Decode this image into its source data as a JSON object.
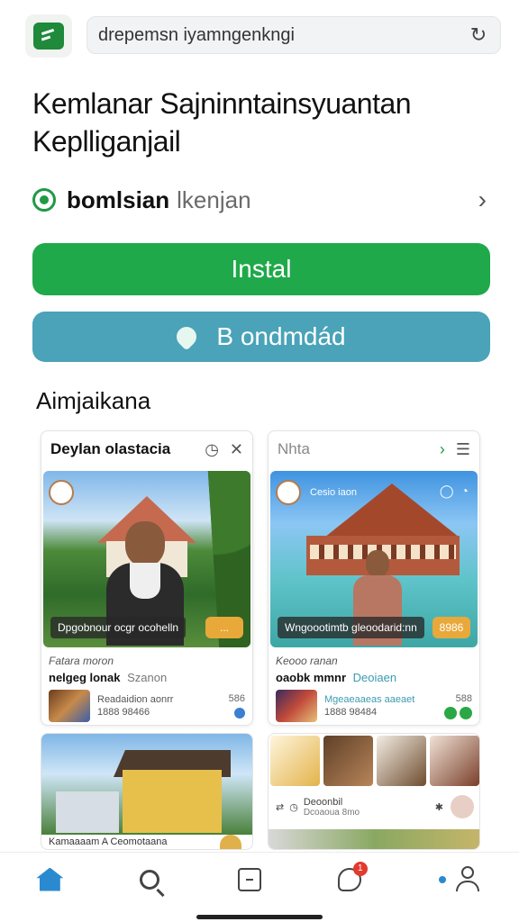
{
  "address_bar": {
    "url_text": "drepemsn iyamngenkngi"
  },
  "page": {
    "title_line1": "Kemlanar Sajninntainsyuantan",
    "title_line2": "Keplliganjail"
  },
  "developer": {
    "name": "bomlsian",
    "sub": "lkenjan"
  },
  "buttons": {
    "install": "Instal",
    "secondary": "B ondmdád"
  },
  "section": {
    "title": "Aimjaikana"
  },
  "cards": [
    {
      "header": "Deylan olastacia",
      "caption": "Dpgobnour ocgr ocohelln",
      "line1": "Fatara moron",
      "line2": "nelgeg lonak",
      "line2_extra": "Szanon",
      "meta1": "Readaidion aonrr",
      "meta2": "1888 98466",
      "side": "586"
    },
    {
      "header": "Nhta",
      "photo_tag": "Cesio iaon",
      "caption": "Wngoootimtb gleoodarid:nn",
      "price": "8986",
      "line1": "Keooo ranan",
      "line2": "oaobk mmnr",
      "line2_extra": "Deoiaen",
      "meta1": "Mgeaeaaeas aaeaet",
      "meta2": "1888 98484",
      "side": "588"
    }
  ],
  "cards_row2": [
    {
      "caption": "Kamaaaam A Ceomotaana"
    },
    {
      "line1": "Deoonbil",
      "line2": "Dcoaoua 8mo"
    }
  ],
  "colors": {
    "install": "#20a94a",
    "secondary": "#4aa3b8",
    "accent_blue": "#2a8ad0"
  },
  "nav": {
    "items": [
      "home-icon",
      "search-icon",
      "square-icon",
      "chat-icon",
      "user-icon"
    ],
    "badge": "1"
  }
}
